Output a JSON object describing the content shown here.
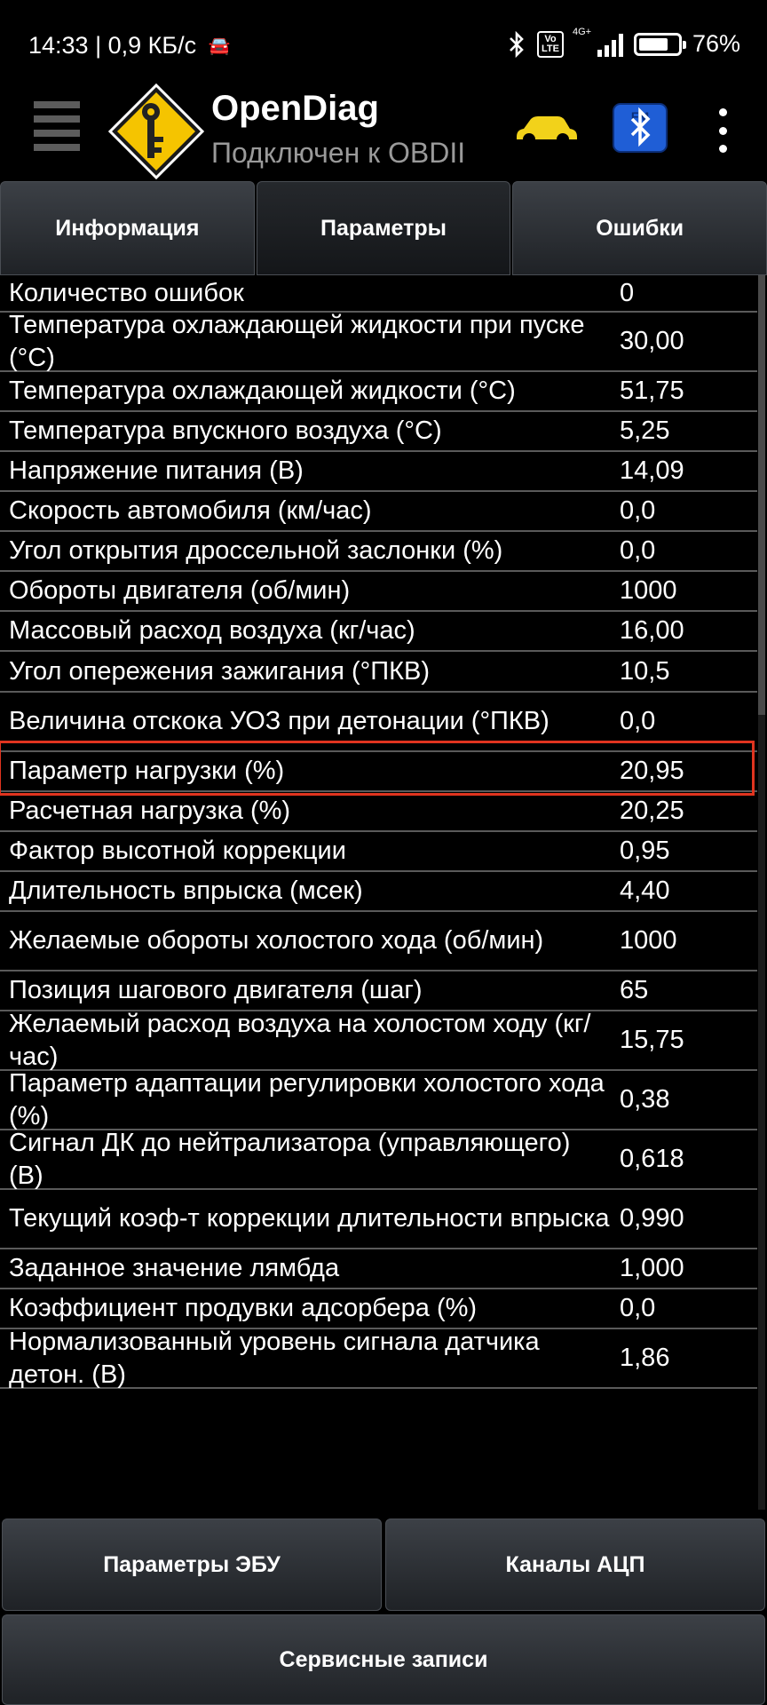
{
  "status_bar": {
    "time": "14:33",
    "speed": "0,9 КБ/с",
    "volte_label": "Vo\nLTE",
    "network": "4G+",
    "battery_pct": "76%",
    "battery_level": 0.76
  },
  "app_bar": {
    "title": "OpenDiag",
    "subtitle": "Подключен к OBDII",
    "btfm_icon_text": "BTFM"
  },
  "tabs": [
    {
      "label": "Информация",
      "active": false
    },
    {
      "label": "Параметры",
      "active": true
    },
    {
      "label": "Ошибки",
      "active": false
    }
  ],
  "parameters": [
    {
      "name": "Количество ошибок",
      "value": "0"
    },
    {
      "name": "Температура охлаждающей жидкости при пуске (°C)",
      "value": "30,00"
    },
    {
      "name": "Температура охлаждающей жидкости (°C)",
      "value": "51,75"
    },
    {
      "name": "Температура впускного воздуха (°C)",
      "value": "5,25"
    },
    {
      "name": "Напряжение питания (В)",
      "value": "14,09"
    },
    {
      "name": "Скорость автомобиля (км/час)",
      "value": "0,0"
    },
    {
      "name": "Угол открытия дроссельной заслонки (%)",
      "value": "0,0"
    },
    {
      "name": "Обороты двигателя (об/мин)",
      "value": "1000"
    },
    {
      "name": "Массовый расход воздуха (кг/час)",
      "value": "16,00"
    },
    {
      "name": "Угол опережения зажигания (°ПКВ)",
      "value": "10,5"
    },
    {
      "name": "Величина отскока УОЗ при детонации (°ПКВ)",
      "value": "0,0"
    },
    {
      "name": "Параметр нагрузки (%)",
      "value": "20,95"
    },
    {
      "name": "Расчетная нагрузка (%)",
      "value": "20,25"
    },
    {
      "name": "Фактор высотной коррекции",
      "value": "0,95"
    },
    {
      "name": "Длительность впрыска (мсек)",
      "value": "4,40"
    },
    {
      "name": "Желаемые обороты холостого хода (об/мин)",
      "value": "1000"
    },
    {
      "name": "Позиция шагового двигателя (шаг)",
      "value": "65"
    },
    {
      "name": "Желаемый расход воздуха на холостом ходу (кг/час)",
      "value": "15,75"
    },
    {
      "name": "Параметр адаптации регулировки холостого хода (%)",
      "value": "0,38"
    },
    {
      "name": "Сигнал ДК до нейтрализатора (управляющего) (В)",
      "value": "0,618"
    },
    {
      "name": "Текущий коэф-т коррекции длительности впрыска",
      "value": "0,990"
    },
    {
      "name": "Заданное значение лямбда",
      "value": "1,000"
    },
    {
      "name": "Коэффициент продувки адсорбера (%)",
      "value": "0,0"
    },
    {
      "name": "Нормализованный уровень сигнала датчика детон. (В)",
      "value": "1,86"
    }
  ],
  "bottom_buttons": {
    "ecu_params": "Параметры ЭБУ",
    "adc_channels": "Каналы АЦП",
    "service_records": "Сервисные записи"
  },
  "colors": {
    "highlight": "#e0341f",
    "logo_yellow": "#f5c400",
    "car_yellow": "#f2d21a",
    "btfm_blue": "#1f5ed6"
  }
}
